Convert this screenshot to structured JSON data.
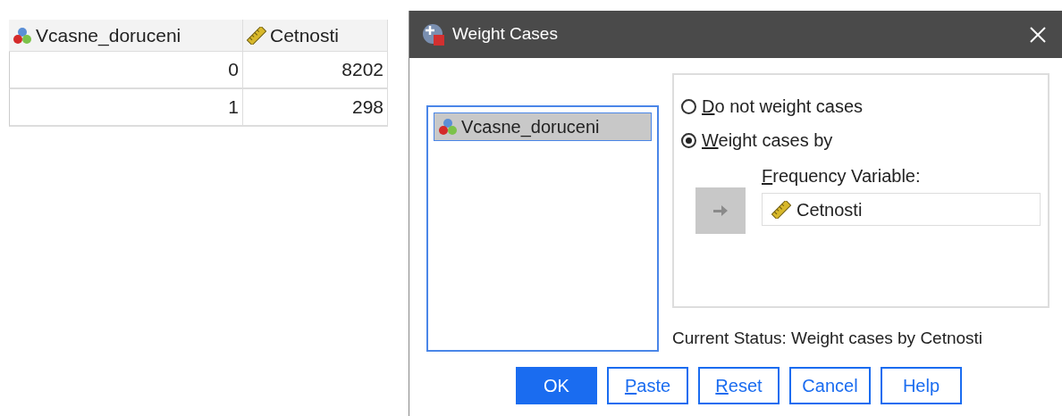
{
  "data_table": {
    "columns": [
      {
        "label": "Vcasne_doruceni",
        "kind": "nominal"
      },
      {
        "label": "Cetnosti",
        "kind": "scale"
      }
    ],
    "rows": [
      [
        "0",
        "8202"
      ],
      [
        "1",
        "298"
      ]
    ]
  },
  "dialog": {
    "title": "Weight Cases",
    "variables": [
      {
        "label": "Vcasne_doruceni",
        "kind": "nominal",
        "selected": true
      }
    ],
    "options": [
      {
        "label": "Do not weight cases",
        "underline_first": true,
        "selected": false
      },
      {
        "label": "Weight cases by",
        "underline_first": true,
        "selected": true
      }
    ],
    "frequency_label": {
      "label": "Frequency Variable:",
      "underline_first": true
    },
    "frequency_variable": {
      "label": "Cetnosti",
      "kind": "scale"
    },
    "current_status": "Current Status: Weight cases by Cetnosti",
    "buttons": [
      {
        "label": "OK",
        "underline_first": false,
        "primary": true
      },
      {
        "label": "Paste",
        "underline_first": true,
        "primary": false
      },
      {
        "label": "Reset",
        "underline_first": true,
        "primary": false
      },
      {
        "label": "Cancel",
        "underline_first": false,
        "primary": false
      },
      {
        "label": "Help",
        "underline_first": false,
        "primary": false
      }
    ]
  }
}
